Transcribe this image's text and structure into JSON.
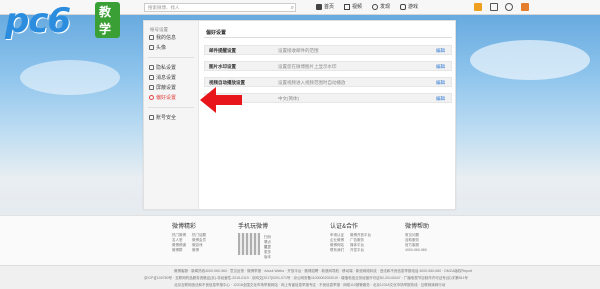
{
  "header": {
    "logo_text": "pc6",
    "logo_tag": "教学",
    "search_placeholder": "搜索微博、找人",
    "nav": [
      {
        "label": "首页"
      },
      {
        "label": "视频"
      },
      {
        "label": "发现"
      },
      {
        "label": "游戏"
      }
    ]
  },
  "sidebar": {
    "heading": "帐号设置",
    "items": [
      {
        "label": "我的信息"
      },
      {
        "label": "头像"
      },
      {
        "label": "隐私设置"
      },
      {
        "label": "消息设置"
      },
      {
        "label": "屏蔽设置"
      },
      {
        "label": "偏好设置"
      },
      {
        "label": "账号安全"
      }
    ]
  },
  "main": {
    "title": "偏好设置",
    "rows": [
      {
        "label": "邮件提醒设置",
        "desc": "设置接收邮件的范围",
        "edit": "编辑"
      },
      {
        "label": "图片水印设置",
        "desc": "设置您在微博图片上显示水印",
        "edit": "编辑"
      },
      {
        "label": "视频自动播放设置",
        "desc": "设置视频进入视频范围时自动播放",
        "edit": "编辑"
      },
      {
        "label": "语言设置",
        "desc": "中文(简体)",
        "edit": "编辑"
      }
    ]
  },
  "footer": {
    "cols": [
      {
        "title": "微博精彩",
        "links": [
          "热门微博",
          "热门话题",
          "名人堂",
          "微博会员",
          "微博频道",
          "微游戏",
          "微博群",
          "微博"
        ]
      },
      {
        "title": "手机玩微博",
        "links": [
          "扫码下载，更多版本",
          "请点这里"
        ]
      },
      {
        "title": "认证&合作",
        "links": [
          "申请认证",
          "微博开放平台",
          "企业微博",
          "广告服务",
          "微博网站",
          "媒体平台",
          "联系我们",
          "开发平台"
        ]
      },
      {
        "title": "微博帮助",
        "links": [
          "常见问题",
          "自助服务",
          "官方客服",
          "4000-960-960"
        ]
      }
    ],
    "bar_lines": [
      "微博客服 · 新闻热线4000-960-960 · 意见反馈 · 微博举报 · About Weibo · 开放平台 · 微博招聘 · 新浪网导航 · 移动端 · 新浪网络科技 · 违法和不良信息举报电话 4000-960-960 · DMCA版权Report",
      "京ICP证100780号 · 互联网药品服务资格证(京)-非经营性-2015-0119 · 京网文[2017]0291-071号 · 京公网安备11000002000019 · 增值电信业务经营许可证B2-20140447 · 广播电视节目制作许可证号(京)字第541号",
      "北京互联网违法和不良信息举报中心 · 12318全国文化市场举报网站 · 网上有害信息举报专区 · 不良信息举报 · 网络110报警服务 · 北京12318文化市场举报热线 · 互联网清网行动"
    ]
  },
  "colors": {
    "accent": "#e14343",
    "link": "#2f7bd2",
    "arrow": "#e8161b",
    "logo": "#2c8dde"
  }
}
